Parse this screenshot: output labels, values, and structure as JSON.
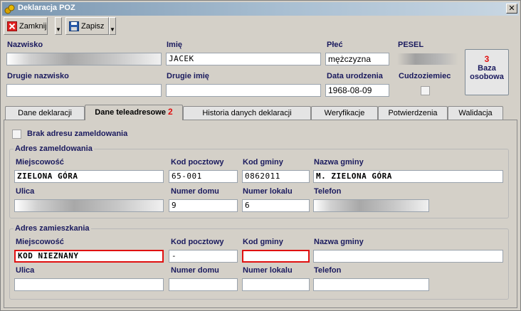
{
  "window": {
    "title": "Deklaracja POZ",
    "close_glyph": "✕"
  },
  "toolbar": {
    "close_label": "Zamknij",
    "save_label": "Zapisz"
  },
  "header": {
    "nazwisko_label": "Nazwisko",
    "nazwisko_value": "",
    "imie_label": "Imię",
    "imie_value": "JACEK",
    "plec_label": "Płeć",
    "plec_value": "mężczyzna",
    "pesel_label": "PESEL",
    "pesel_value": "",
    "drugie_nazwisko_label": "Drugie nazwisko",
    "drugie_nazwisko_value": "",
    "drugie_imie_label": "Drugie imię",
    "drugie_imie_value": "",
    "data_urodzenia_label": "Data urodzenia",
    "data_urodzenia_value": "1968-08-09",
    "cudzoziemiec_label": "Cudzoziemiec",
    "baza_count": "3",
    "baza_line1": "Baza",
    "baza_line2": "osobowa"
  },
  "tabs": [
    {
      "label": "Dane deklaracji"
    },
    {
      "label": "Dane teleadresowe",
      "badge": "2"
    },
    {
      "label": "Historia danych deklaracji"
    },
    {
      "label": "Weryfikacje"
    },
    {
      "label": "Potwierdzenia"
    },
    {
      "label": "Walidacja"
    }
  ],
  "brak_adresu_label": "Brak adresu zameldowania",
  "zameldowania": {
    "title": "Adres zameldowania",
    "miejscowosc_label": "Miejscowość",
    "miejscowosc_value": "ZIELONA GÓRA",
    "kod_pocztowy_label": "Kod pocztowy",
    "kod_pocztowy_value": "65-001",
    "kod_gminy_label": "Kod gminy",
    "kod_gminy_value": "0862011",
    "nazwa_gminy_label": "Nazwa gminy",
    "nazwa_gminy_value": "M. ZIELONA GÓRA",
    "ulica_label": "Ulica",
    "ulica_value": "",
    "numer_domu_label": "Numer domu",
    "numer_domu_value": "9",
    "numer_lokalu_label": "Numer lokalu",
    "numer_lokalu_value": "6",
    "telefon_label": "Telefon",
    "telefon_value": ""
  },
  "zamieszkania": {
    "title": "Adres zamieszkania",
    "miejscowosc_label": "Miejscowość",
    "miejscowosc_value": "KOD NIEZNANY",
    "kod_pocztowy_label": "Kod pocztowy",
    "kod_pocztowy_value": "-",
    "kod_gminy_label": "Kod gminy",
    "kod_gminy_value": "",
    "nazwa_gminy_label": "Nazwa gminy",
    "nazwa_gminy_value": "",
    "ulica_label": "Ulica",
    "ulica_value": "",
    "numer_domu_label": "Numer domu",
    "numer_domu_value": "",
    "numer_lokalu_label": "Numer lokalu",
    "numer_lokalu_value": "",
    "telefon_label": "Telefon",
    "telefon_value": ""
  },
  "colors": {
    "error_border": "#e01010",
    "label_text": "#1a1a5e",
    "title_gradient_start": "#7a96b0"
  },
  "icons": {
    "app": "medal-icon",
    "close_tool": "red-x-icon",
    "save_tool": "floppy-disk-icon",
    "dropdown": "dropdown-arrow-icon"
  }
}
